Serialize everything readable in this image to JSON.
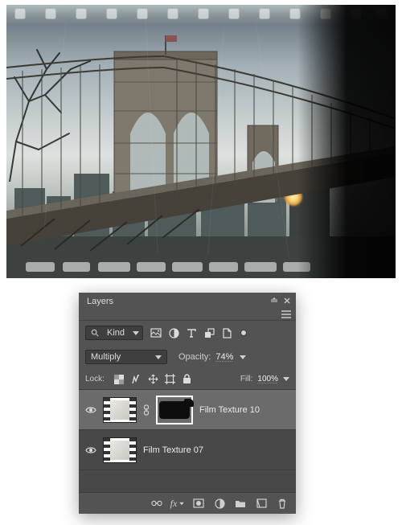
{
  "panel": {
    "title": "Layers",
    "filter": {
      "kind": "Kind"
    },
    "blend": {
      "mode": "Multiply",
      "opacity_label": "Opacity:",
      "opacity_value": "74%"
    },
    "lock": {
      "label": "Lock:",
      "fill_label": "Fill:",
      "fill_value": "100%"
    },
    "layers": [
      {
        "name": "Film Texture 10",
        "selected": true,
        "visible": true,
        "has_mask": true
      },
      {
        "name": "Film Texture 07",
        "selected": false,
        "visible": true,
        "has_mask": false
      }
    ]
  }
}
